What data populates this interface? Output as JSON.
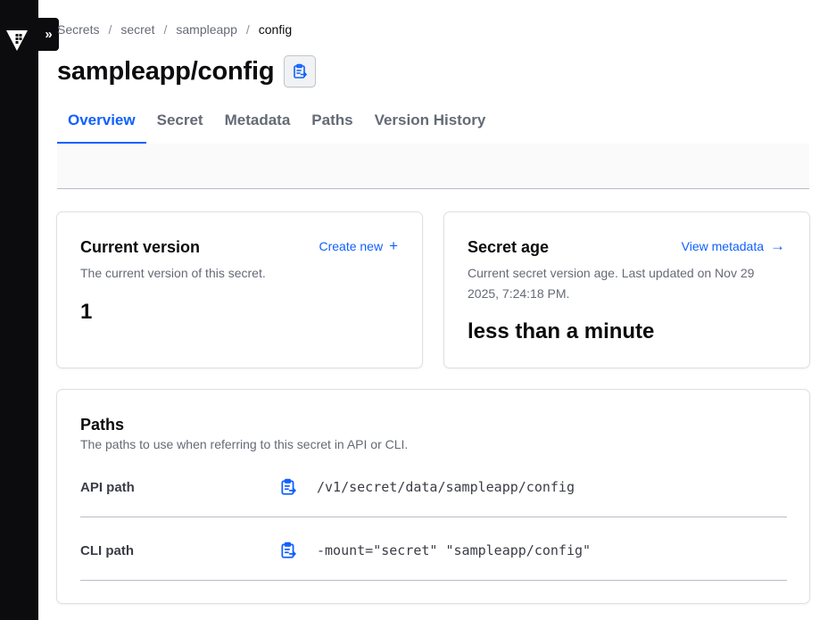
{
  "breadcrumb": [
    "Secrets",
    "secret",
    "sampleapp",
    "config"
  ],
  "breadcrumb_separator": "/",
  "expand_label": "»",
  "page_title": "sampleapp/config",
  "tabs": [
    "Overview",
    "Secret",
    "Metadata",
    "Paths",
    "Version History"
  ],
  "active_tab": "Overview",
  "current_version": {
    "title": "Current version",
    "action_label": "Create new",
    "action_icon": "plus-icon",
    "description": "The current version of this secret.",
    "value": "1"
  },
  "secret_age": {
    "title": "Secret age",
    "action_label": "View metadata",
    "action_icon": "arrow-right-icon",
    "description": "Current secret version age. Last updated on Nov 29 2025, 7:24:18 PM.",
    "value": "less than a minute"
  },
  "paths": {
    "title": "Paths",
    "description": "The paths to use when referring to this secret in API or CLI.",
    "rows": [
      {
        "label": "API path",
        "value": "/v1/secret/data/sampleapp/config"
      },
      {
        "label": "CLI path",
        "value": "-mount=\"secret\" \"sampleapp/config\""
      }
    ]
  },
  "colors": {
    "accent": "#1060ff",
    "sidebar": "#0c0c0e",
    "text_primary": "#0c0c0e",
    "text_muted": "#656a76"
  },
  "icons": {
    "logo": "vault-logo-icon",
    "expand": "chevrons-right-icon",
    "copy": "clipboard-copy-icon"
  }
}
